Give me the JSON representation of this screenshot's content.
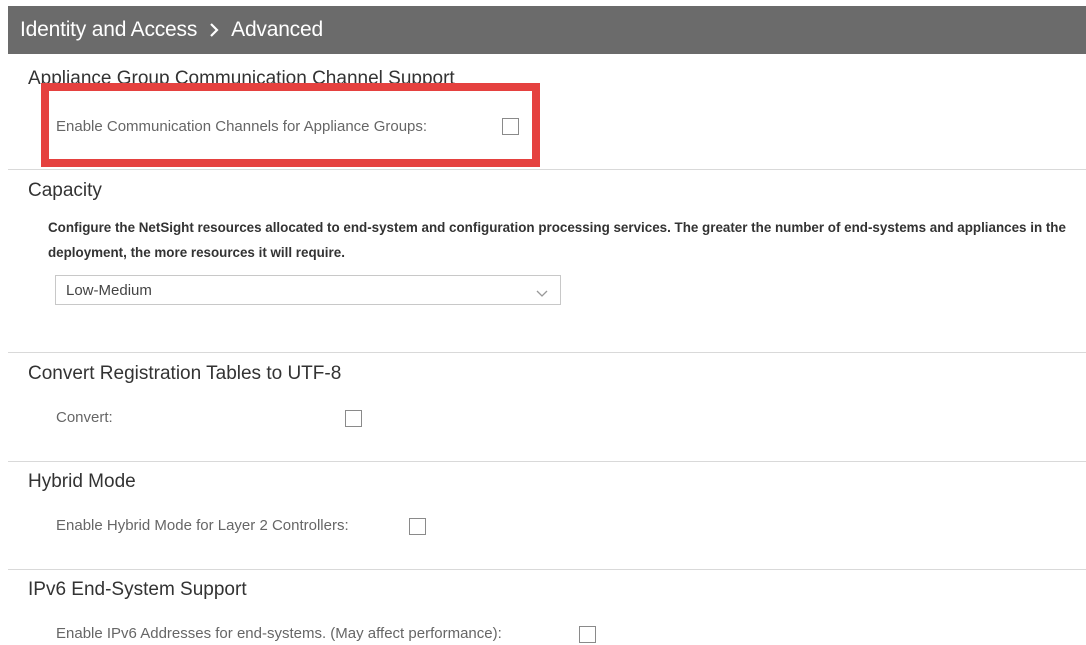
{
  "header": {
    "crumb_root": "Identity and Access",
    "separator_icon": "chevron-right-icon",
    "crumb_current": "Advanced"
  },
  "sections": {
    "appliance_group": {
      "title": "Appliance Group Communication Channel Support",
      "field_label": "Enable Communication Channels for Appliance Groups:",
      "checked": false
    },
    "capacity": {
      "title": "Capacity",
      "description": "Configure the NetSight resources allocated to end-system and configuration processing services. The greater the number of end-systems and appliances in the deployment, the more resources it will require.",
      "select_value": "Low-Medium",
      "select_icon": "chevron-down-icon"
    },
    "convert": {
      "title": "Convert Registration Tables to UTF-8",
      "field_label": "Convert:",
      "checked": false
    },
    "hybrid": {
      "title": "Hybrid Mode",
      "field_label": "Enable Hybrid Mode for Layer 2 Controllers:",
      "checked": false
    },
    "ipv6": {
      "title": "IPv6 End-System Support",
      "field_label": "Enable IPv6 Addresses for end-systems. (May affect performance):",
      "checked": false
    }
  },
  "colors": {
    "header_bg": "#6b6b6b",
    "highlight_border": "#e5413f",
    "divider": "#d9d9d9"
  }
}
